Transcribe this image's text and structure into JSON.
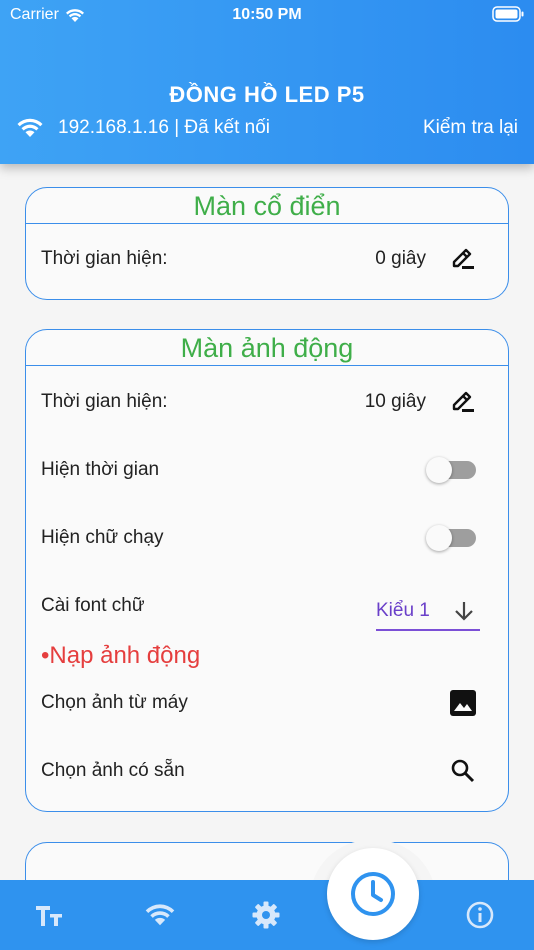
{
  "status_bar": {
    "carrier": "Carrier",
    "time": "10:50 PM"
  },
  "header": {
    "title": "ĐỒNG HỒ LED P5",
    "connection": "192.168.1.16 | Đã kết nối",
    "recheck_label": "Kiểm tra lại"
  },
  "classic_card": {
    "title": "Màn cổ điển",
    "display_time_label": "Thời gian hiện:",
    "display_time_value": "0 giây"
  },
  "animation_card": {
    "title": "Màn ảnh động",
    "display_time_label": "Thời gian hiện:",
    "display_time_value": "10 giây",
    "show_time_label": "Hiện thời gian",
    "show_time_enabled": false,
    "show_marquee_label": "Hiện chữ chạy",
    "show_marquee_enabled": false,
    "font_label": "Cài font chữ",
    "font_value": "Kiểu 1",
    "upload_section_label": "•Nạp ảnh động",
    "pick_device_label": "Chọn ảnh từ máy",
    "pick_preset_label": "Chọn ảnh có sẵn"
  },
  "colors": {
    "header_blue": "#2f93ef",
    "card_border": "#3b8eea",
    "title_green": "#3fae49",
    "section_red": "#e53e3e",
    "select_purple": "#7b4fd6"
  },
  "bottom_nav": {
    "items": [
      {
        "icon": "text-size-icon"
      },
      {
        "icon": "wifi-icon"
      },
      {
        "icon": "settings-gear-icon"
      },
      {
        "icon": "clock-icon",
        "active": true
      },
      {
        "icon": "info-icon"
      }
    ]
  }
}
